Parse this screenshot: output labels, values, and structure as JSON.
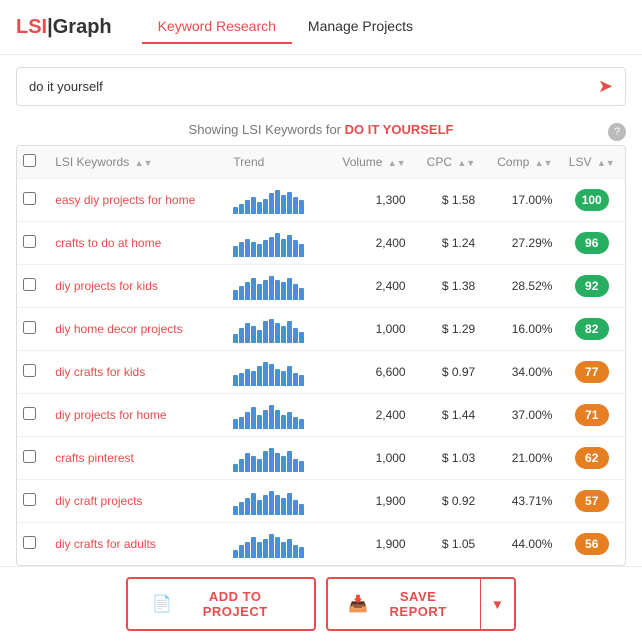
{
  "header": {
    "logo_lsi": "LSI",
    "logo_graph": "Graph",
    "nav": [
      {
        "id": "keyword-research",
        "label": "Keyword Research",
        "active": true
      },
      {
        "id": "manage-projects",
        "label": "Manage Projects",
        "active": false
      }
    ]
  },
  "search": {
    "placeholder": "do it yourself",
    "value": "do it yourself"
  },
  "showing": {
    "prefix": "Showing LSI Keywords for ",
    "keyword": "DO IT YOURSELF"
  },
  "table": {
    "columns": [
      {
        "id": "check",
        "label": ""
      },
      {
        "id": "keyword",
        "label": "LSI Keywords",
        "sortable": true
      },
      {
        "id": "trend",
        "label": "Trend"
      },
      {
        "id": "volume",
        "label": "Volume",
        "sortable": true
      },
      {
        "id": "cpc",
        "label": "CPC",
        "sortable": true
      },
      {
        "id": "comp",
        "label": "Comp",
        "sortable": true
      },
      {
        "id": "lsv",
        "label": "LSV",
        "sortable": true
      }
    ],
    "rows": [
      {
        "keyword": "easy diy projects for home",
        "volume": "1,300",
        "cpc": "$ 1.58",
        "comp": "17.00%",
        "lsv": 100,
        "lsv_color": "green",
        "trend": [
          4,
          6,
          8,
          10,
          7,
          9,
          12,
          14,
          11,
          13,
          10,
          8
        ]
      },
      {
        "keyword": "crafts to do at home",
        "volume": "2,400",
        "cpc": "$ 1.24",
        "comp": "27.29%",
        "lsv": 96,
        "lsv_color": "green",
        "trend": [
          6,
          8,
          10,
          8,
          7,
          9,
          11,
          13,
          10,
          12,
          9,
          7
        ]
      },
      {
        "keyword": "diy projects for kids",
        "volume": "2,400",
        "cpc": "$ 1.38",
        "comp": "28.52%",
        "lsv": 92,
        "lsv_color": "green",
        "trend": [
          5,
          7,
          9,
          11,
          8,
          10,
          12,
          10,
          9,
          11,
          8,
          6
        ]
      },
      {
        "keyword": "diy home decor projects",
        "volume": "1,000",
        "cpc": "$ 1.29",
        "comp": "16.00%",
        "lsv": 82,
        "lsv_color": "green",
        "trend": [
          4,
          7,
          9,
          8,
          6,
          10,
          11,
          9,
          8,
          10,
          7,
          5
        ]
      },
      {
        "keyword": "diy crafts for kids",
        "volume": "6,600",
        "cpc": "$ 0.97",
        "comp": "34.00%",
        "lsv": 77,
        "lsv_color": "orange",
        "trend": [
          5,
          6,
          8,
          7,
          9,
          11,
          10,
          8,
          7,
          9,
          6,
          5
        ]
      },
      {
        "keyword": "diy projects for home",
        "volume": "2,400",
        "cpc": "$ 1.44",
        "comp": "37.00%",
        "lsv": 71,
        "lsv_color": "orange",
        "trend": [
          4,
          5,
          7,
          9,
          6,
          8,
          10,
          8,
          6,
          7,
          5,
          4
        ]
      },
      {
        "keyword": "crafts pinterest",
        "volume": "1,000",
        "cpc": "$ 1.03",
        "comp": "21.00%",
        "lsv": 62,
        "lsv_color": "orange",
        "trend": [
          3,
          5,
          7,
          6,
          5,
          8,
          9,
          7,
          6,
          8,
          5,
          4
        ]
      },
      {
        "keyword": "diy craft projects",
        "volume": "1,900",
        "cpc": "$ 0.92",
        "comp": "43.71%",
        "lsv": 57,
        "lsv_color": "orange",
        "trend": [
          4,
          6,
          8,
          10,
          7,
          9,
          11,
          9,
          8,
          10,
          7,
          5
        ]
      },
      {
        "keyword": "diy crafts for adults",
        "volume": "1,900",
        "cpc": "$ 1.05",
        "comp": "44.00%",
        "lsv": 56,
        "lsv_color": "orange",
        "trend": [
          3,
          5,
          6,
          8,
          6,
          7,
          9,
          8,
          6,
          7,
          5,
          4
        ]
      }
    ]
  },
  "footer": {
    "add_label": "ADD TO PROJECT",
    "save_label": "SAVE REPORT"
  }
}
